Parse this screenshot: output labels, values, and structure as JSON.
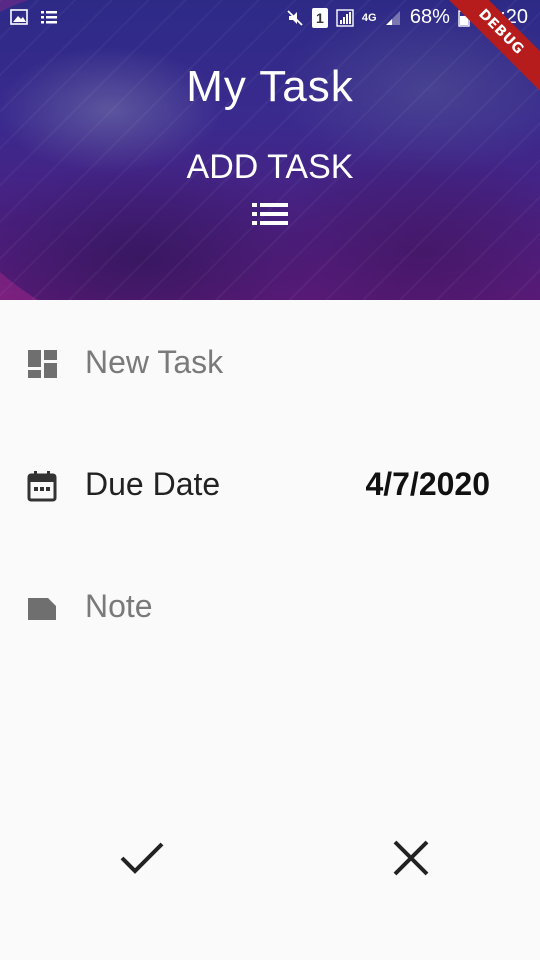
{
  "status_bar": {
    "battery": "68%",
    "time": "18:20",
    "sim": "1",
    "network": "4G",
    "icons": [
      "image-icon",
      "list-icon",
      "mute-icon",
      "sim-icon",
      "signal-icon",
      "network-4g-icon",
      "signal-weak-icon",
      "battery-icon"
    ]
  },
  "header": {
    "title": "My Task",
    "subtitle": "ADD TASK",
    "icon": "list-icon",
    "debug_banner": "DEBUG"
  },
  "form": {
    "task": {
      "placeholder": "New Task",
      "icon": "dashboard-icon"
    },
    "due_date": {
      "label": "Due Date",
      "value": "4/7/2020",
      "icon": "calendar-icon"
    },
    "note": {
      "placeholder": "Note",
      "icon": "label-icon"
    }
  },
  "actions": {
    "confirm_icon": "check-icon",
    "cancel_icon": "close-icon"
  },
  "colors": {
    "header_primary": "#3a2a8e",
    "header_accent": "#aa2a8c",
    "debug_banner": "#b71c1c",
    "background": "#fafafa"
  }
}
